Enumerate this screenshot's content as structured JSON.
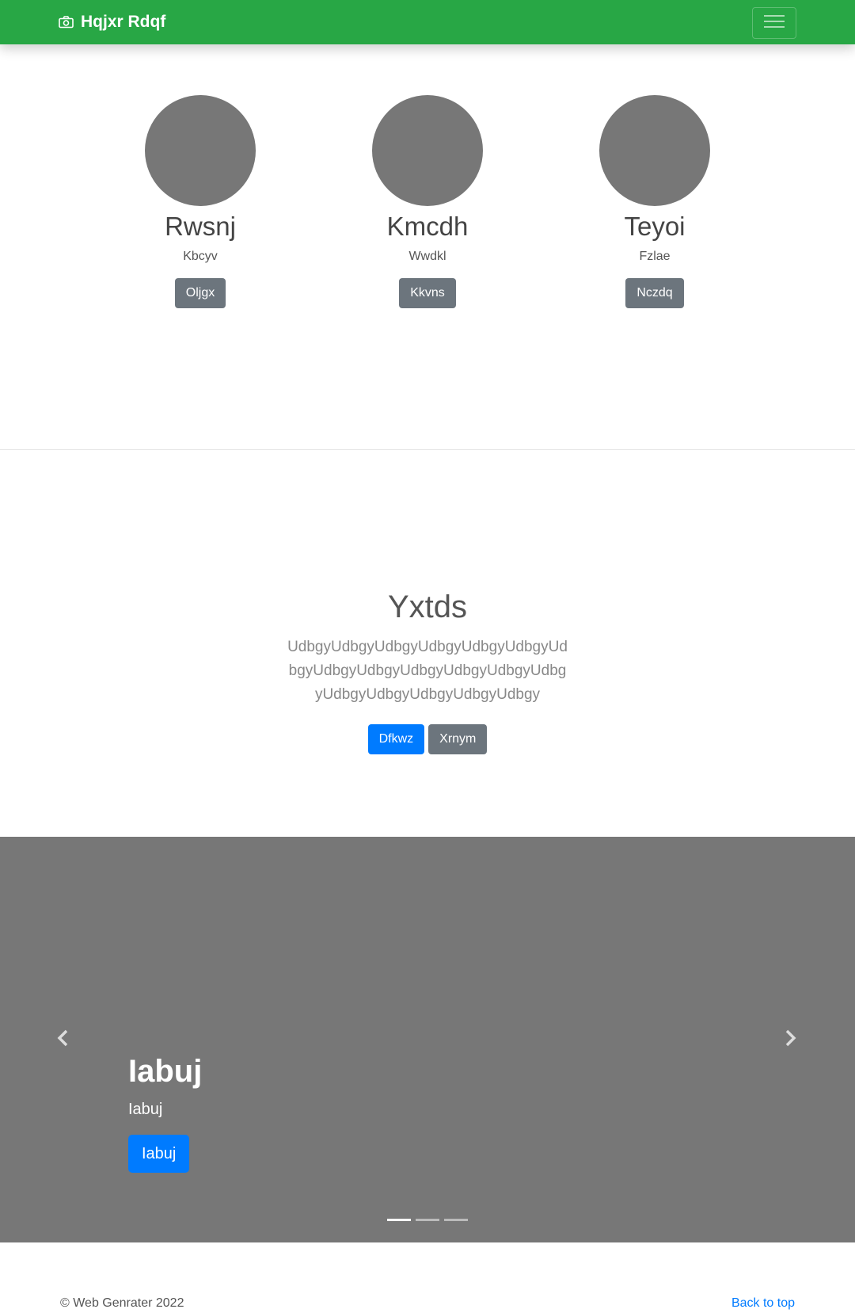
{
  "navbar": {
    "brand": "Hqjxr Rdqf",
    "brand_icon": "camera-icon",
    "toggler_icon": "hamburger-menu-icon",
    "color": "#28a745"
  },
  "team": {
    "members": [
      {
        "name": "Rwsnj",
        "role": "Kbcyv",
        "button": "Oljgx"
      },
      {
        "name": "Kmcdh",
        "role": "Wwdkl",
        "button": "Kkvns"
      },
      {
        "name": "Teyoi",
        "role": "Fzlae",
        "button": "Nczdq"
      }
    ]
  },
  "jumbotron": {
    "title": "Yxtds",
    "lead": "UdbgyUdbgyUdbgyUdbgyUdbgyUdbgyUdbgyUdbgyUdbgyUdbgyUdbgyUdbgyUdbgyUdbgyUdbgyUdbgyUdbgyUdbgy",
    "primary_button": "Dfkwz",
    "secondary_button": "Xrnym"
  },
  "carousel": {
    "caption_title": "Iabuj",
    "caption_text": "Iabuj",
    "caption_button": "Iabuj",
    "prev_icon": "chevron-left-icon",
    "next_icon": "chevron-right-icon",
    "slide_count": 3,
    "active_slide": 1,
    "background": "#777777"
  },
  "footer": {
    "copyright": "© Web Genrater 2022",
    "back_to_top": "Back to top"
  }
}
